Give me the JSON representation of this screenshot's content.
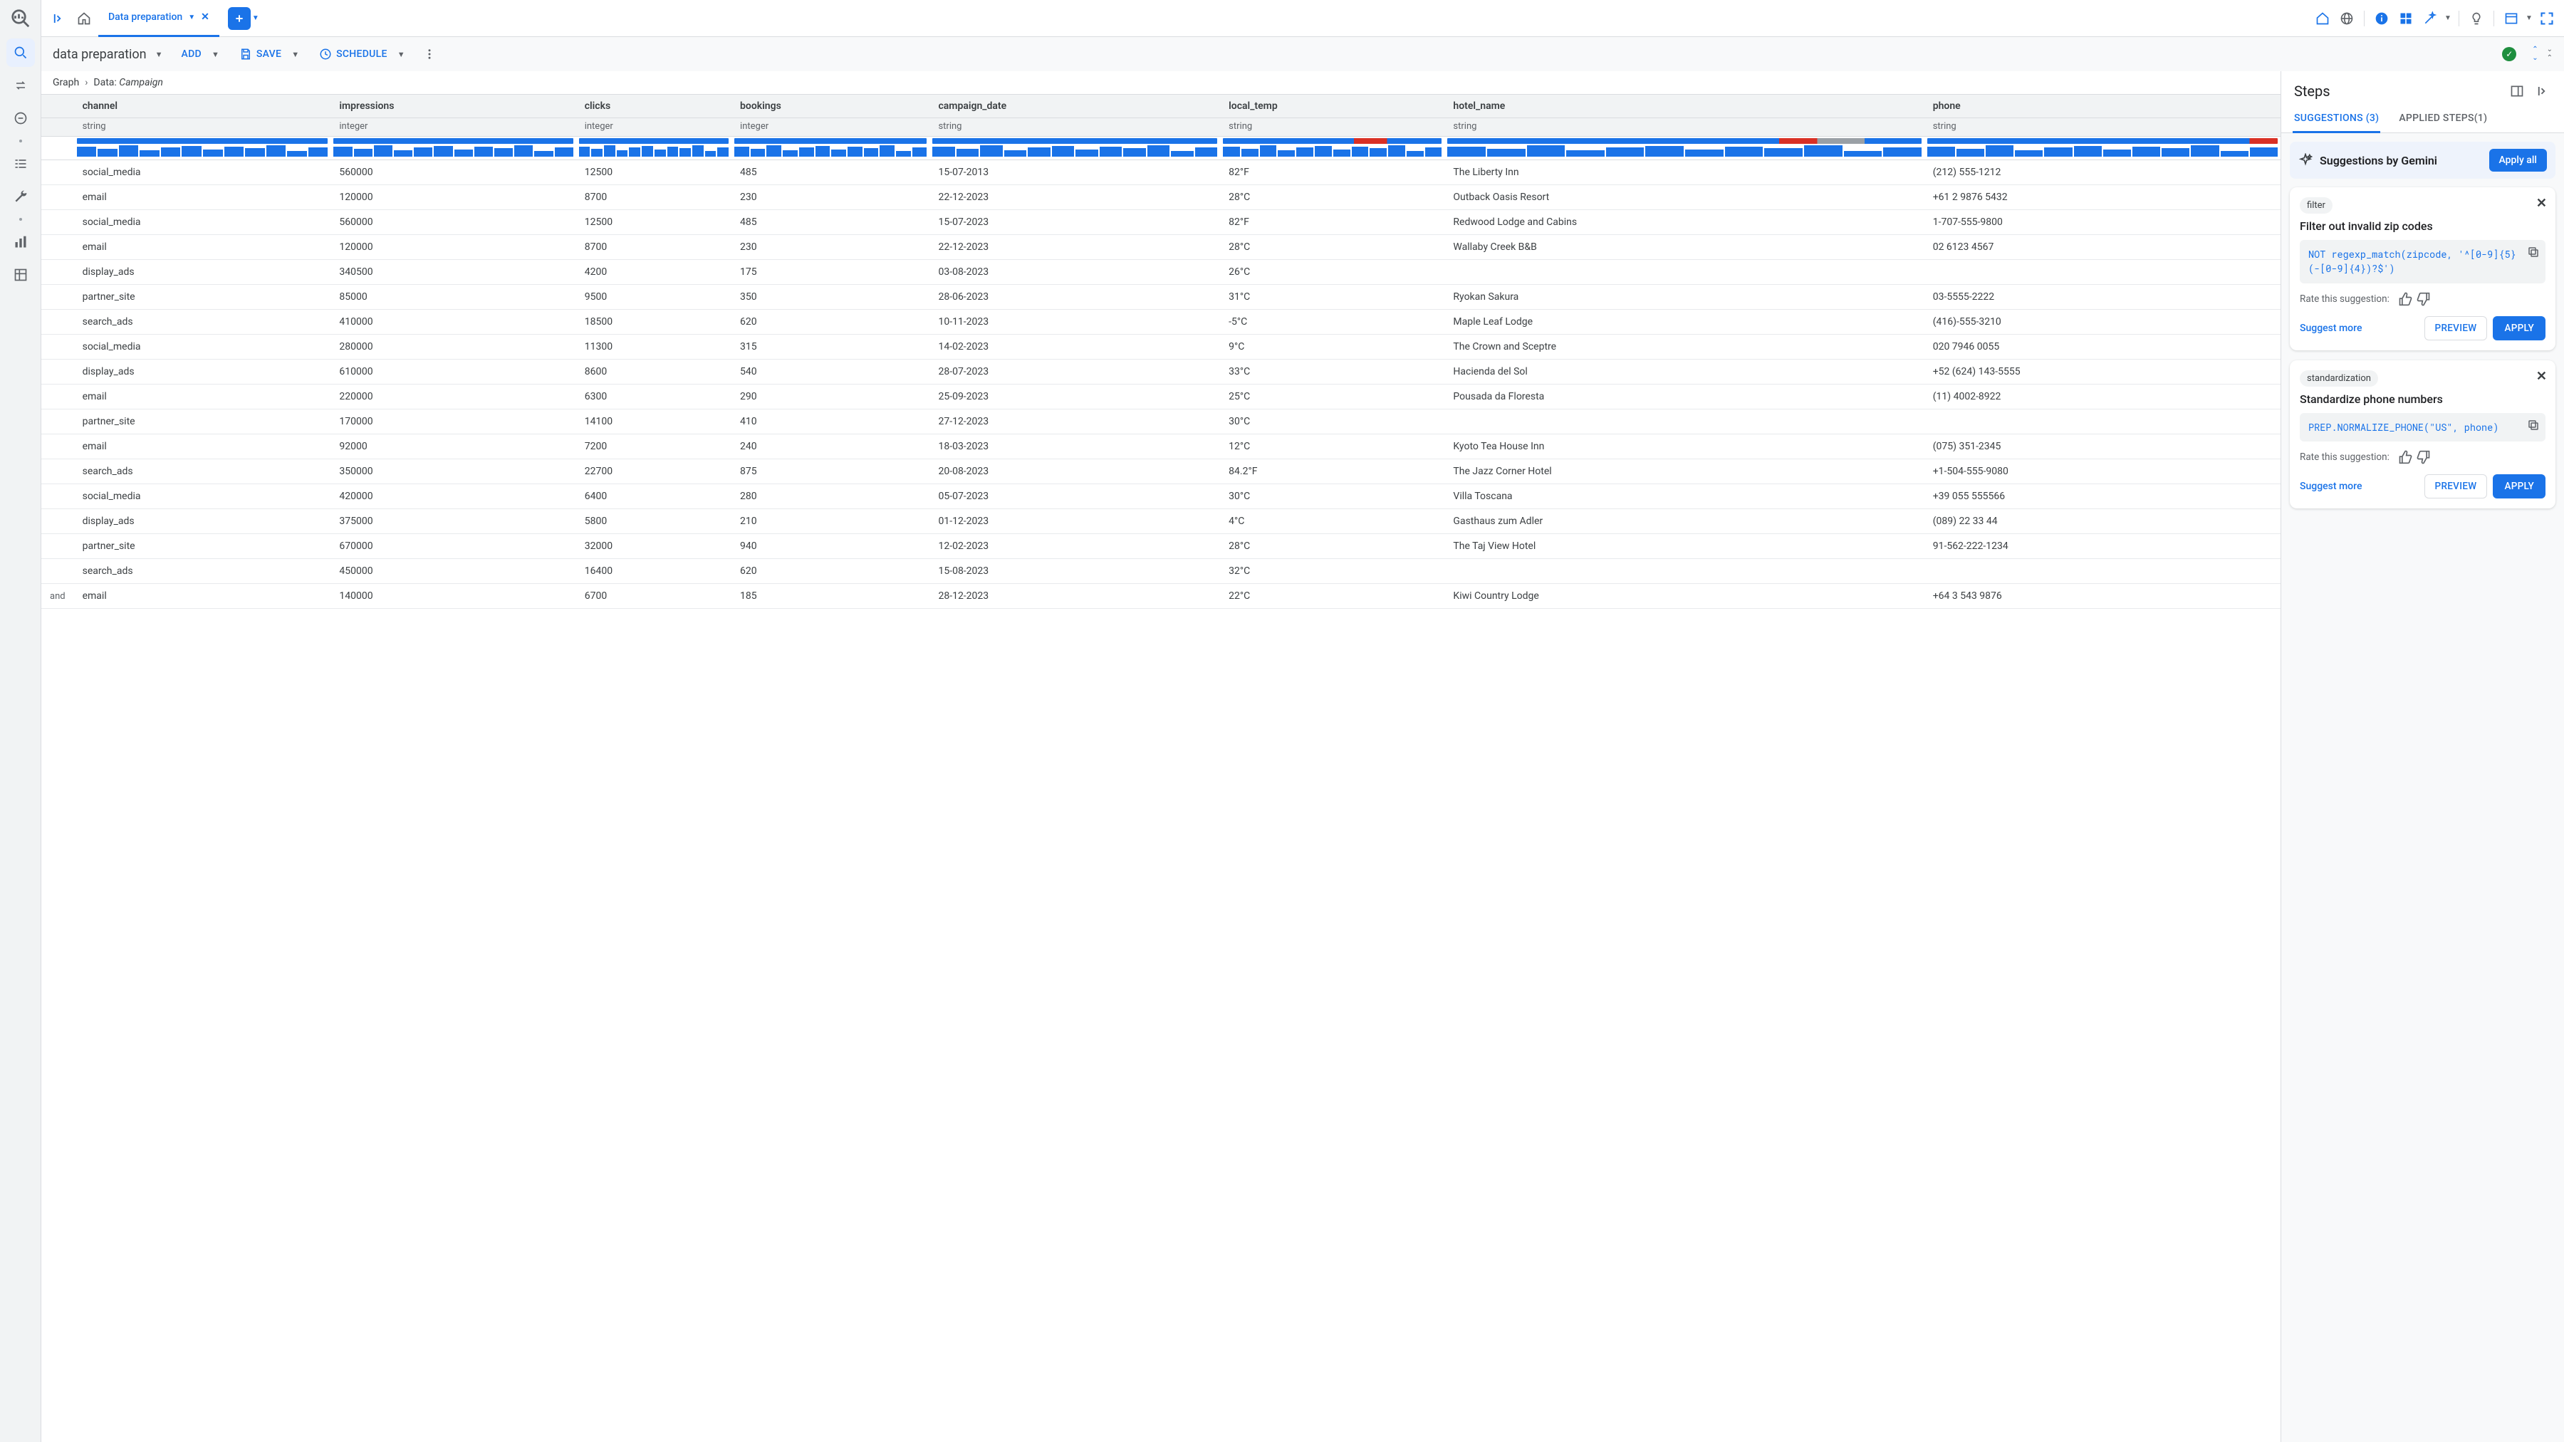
{
  "top": {
    "tab_label": "Data preparation"
  },
  "toolbar": {
    "title": "data preparation",
    "add": "ADD",
    "save": "SAVE",
    "schedule": "SCHEDULE"
  },
  "breadcrumb": {
    "graph": "Graph",
    "data_prefix": "Data: ",
    "data_name": "Campaign"
  },
  "columns": [
    {
      "name": "channel",
      "type": "string"
    },
    {
      "name": "impressions",
      "type": "integer"
    },
    {
      "name": "clicks",
      "type": "integer"
    },
    {
      "name": "bookings",
      "type": "integer"
    },
    {
      "name": "campaign_date",
      "type": "string"
    },
    {
      "name": "local_temp",
      "type": "string"
    },
    {
      "name": "hotel_name",
      "type": "string"
    },
    {
      "name": "phone",
      "type": "string"
    }
  ],
  "rows": [
    [
      "social_media",
      "560000",
      "12500",
      "485",
      "15-07-2013",
      "82°F",
      "The Liberty Inn",
      "(212) 555-1212"
    ],
    [
      "email",
      "120000",
      "8700",
      "230",
      "22-12-2023",
      "28°C",
      "Outback Oasis Resort",
      "+61 2 9876 5432"
    ],
    [
      "social_media",
      "560000",
      "12500",
      "485",
      "15-07-2023",
      "82°F",
      "Redwood Lodge and Cabins",
      "1-707-555-9800"
    ],
    [
      "email",
      "120000",
      "8700",
      "230",
      "22-12-2023",
      "28°C",
      "Wallaby Creek B&B",
      "02 6123 4567"
    ],
    [
      "display_ads",
      "340500",
      "4200",
      "175",
      "03-08-2023",
      "26°C",
      "",
      ""
    ],
    [
      "partner_site",
      "85000",
      "9500",
      "350",
      "28-06-2023",
      "31°C",
      "Ryokan Sakura",
      "03-5555-2222"
    ],
    [
      "search_ads",
      "410000",
      "18500",
      "620",
      "10-11-2023",
      "-5°C",
      "Maple Leaf Lodge",
      "(416)-555-3210"
    ],
    [
      "social_media",
      "280000",
      "11300",
      "315",
      "14-02-2023",
      "9°C",
      "The Crown and Sceptre",
      "020 7946 0055"
    ],
    [
      "display_ads",
      "610000",
      "8600",
      "540",
      "28-07-2023",
      "33°C",
      "Hacienda del Sol",
      "+52 (624) 143-5555"
    ],
    [
      "email",
      "220000",
      "6300",
      "290",
      "25-09-2023",
      "25°C",
      "Pousada da Floresta",
      "(11) 4002-8922"
    ],
    [
      "partner_site",
      "170000",
      "14100",
      "410",
      "27-12-2023",
      "30°C",
      "",
      ""
    ],
    [
      "email",
      "92000",
      "7200",
      "240",
      "18-03-2023",
      "12°C",
      "Kyoto Tea House Inn",
      "(075) 351-2345"
    ],
    [
      "search_ads",
      "350000",
      "22700",
      "875",
      "20-08-2023",
      "84.2°F",
      "The Jazz Corner Hotel",
      "+1-504-555-9080"
    ],
    [
      "social_media",
      "420000",
      "6400",
      "280",
      "05-07-2023",
      "30°C",
      "Villa Toscana",
      "+39 055 555566"
    ],
    [
      "display_ads",
      "375000",
      "5800",
      "210",
      "01-12-2023",
      "4°C",
      "Gasthaus zum Adler",
      "(089) 22 33 44"
    ],
    [
      "partner_site",
      "670000",
      "32000",
      "940",
      "12-02-2023",
      "28°C",
      "The Taj View Hotel",
      "91-562-222-1234"
    ],
    [
      "search_ads",
      "450000",
      "16400",
      "620",
      "15-08-2023",
      "32°C",
      "",
      ""
    ],
    [
      "email",
      "140000",
      "6700",
      "185",
      "28-12-2023",
      "22°C",
      "Kiwi Country Lodge",
      "+64 3 543 9876"
    ]
  ],
  "steps": {
    "title": "Steps",
    "tab_suggestions": "SUGGESTIONS (3)",
    "tab_applied": "APPLIED STEPS(1)",
    "gemini_title": "Suggestions by Gemini",
    "apply_all": "Apply all",
    "rate_label": "Rate this suggestion:",
    "suggest_more": "Suggest more",
    "preview": "PREVIEW",
    "apply": "APPLY",
    "cards": [
      {
        "chip": "filter",
        "title": "Filter out invalid zip codes",
        "code": "NOT regexp_match(zipcode, '^[0-9]{5}(-[0-9]{4})?$')"
      },
      {
        "chip": "standardization",
        "title": "Standardize phone numbers",
        "code": "PREP.NORMALIZE_PHONE(\"US\", phone)"
      }
    ]
  },
  "row_stub": "and"
}
